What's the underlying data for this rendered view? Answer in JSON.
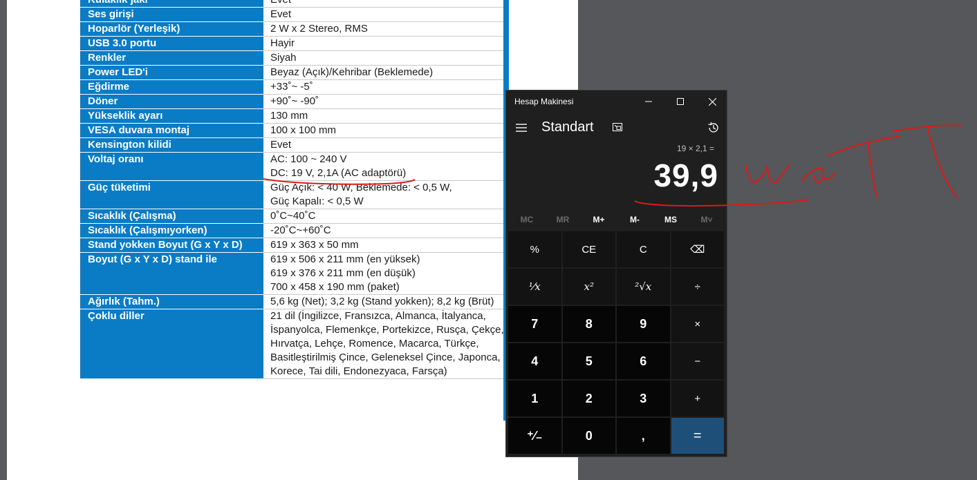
{
  "document": {
    "specs": [
      {
        "label": "Kulaklık jakı",
        "value": [
          "Evet"
        ]
      },
      {
        "label": "Ses girişi",
        "value": [
          "Evet"
        ]
      },
      {
        "label": "Hoparlör (Yerleşik)",
        "value": [
          "2 W x 2 Stereo, RMS"
        ]
      },
      {
        "label": "USB 3.0 portu",
        "value": [
          "Hayir"
        ]
      },
      {
        "label": "Renkler",
        "value": [
          "Siyah"
        ]
      },
      {
        "label": "Power LED'i",
        "value": [
          "Beyaz (Açık)/Kehribar (Beklemede)"
        ]
      },
      {
        "label": "Eğdirme",
        "value": [
          "+33˚~ -5˚"
        ]
      },
      {
        "label": "Döner",
        "value": [
          "+90˚~ -90˚"
        ]
      },
      {
        "label": "Yükseklik ayarı",
        "value": [
          "130 mm"
        ]
      },
      {
        "label": "VESA duvara montaj",
        "value": [
          "100 x 100 mm"
        ]
      },
      {
        "label": "Kensington kilidi",
        "value": [
          "Evet"
        ]
      },
      {
        "label": "Voltaj oranı",
        "value": [
          "AC: 100 ~ 240 V",
          "DC: 19 V, 2,1A (AC adaptörü)"
        ]
      },
      {
        "label": "Güç tüketimi",
        "value": [
          "Güç Açık: < 40 W, Beklemede: < 0,5 W,",
          "Güç Kapalı: < 0,5 W"
        ]
      },
      {
        "label": "Sıcaklık (Çalışma)",
        "value": [
          "0˚C~40˚C"
        ]
      },
      {
        "label": "Sıcaklık (Çalışmıyorken)",
        "value": [
          "-20˚C~+60˚C"
        ]
      },
      {
        "label": "Stand yokken Boyut (G x Y x D)",
        "value": [
          "619 x 363 x 50 mm"
        ]
      },
      {
        "label": "Boyut (G x Y x D) stand ile",
        "value": [
          "619 x 506 x 211 mm (en yüksek)",
          "619 x 376 x 211 mm (en düşük)",
          "700 x 458 x 190 mm (paket)"
        ]
      },
      {
        "label": "Ağırlık (Tahm.)",
        "value": [
          "5,6 kg (Net); 3,2 kg (Stand yokken); 8,2 kg (Brüt)"
        ]
      },
      {
        "label": "Çoklu diller",
        "value": [
          "21 dil (İngilizce, Fransızca, Almanca, İtalyanca, İspanyolca, Flemenkçe, Portekizce, Rusça, Çekçe, Hırvatça, Lehçe, Romence, Macarca, Türkçe, Basitleştirilmiş Çince, Geleneksel Çince, Japonca, Korece, Tai dili, Endonezyaca, Farsça)"
        ]
      }
    ]
  },
  "calculator": {
    "window_title": "Hesap Makinesi",
    "mode": "Standart",
    "expression": "19 × 2,1 =",
    "result": "39,9",
    "memory_buttons": [
      {
        "label": "MC",
        "enabled": false
      },
      {
        "label": "MR",
        "enabled": false
      },
      {
        "label": "M+",
        "enabled": true
      },
      {
        "label": "M-",
        "enabled": true
      },
      {
        "label": "MS",
        "enabled": true
      },
      {
        "label": "M˅",
        "enabled": false
      }
    ],
    "keys": [
      {
        "label": "%",
        "kind": "fn",
        "name": "percent-button"
      },
      {
        "label": "CE",
        "kind": "fn",
        "name": "clear-entry-button"
      },
      {
        "label": "C",
        "kind": "fn",
        "name": "clear-button"
      },
      {
        "label": "⌫",
        "kind": "fn",
        "name": "backspace-button"
      },
      {
        "label": "¹⁄x",
        "kind": "fn",
        "name": "reciprocal-button",
        "italic": true
      },
      {
        "label": "x²",
        "kind": "fn",
        "name": "square-button",
        "italic": true
      },
      {
        "label": "²√x",
        "kind": "fn",
        "name": "square-root-button",
        "italic": true
      },
      {
        "label": "÷",
        "kind": "fn",
        "name": "divide-button"
      },
      {
        "label": "7",
        "kind": "num",
        "name": "digit-7-button"
      },
      {
        "label": "8",
        "kind": "num",
        "name": "digit-8-button"
      },
      {
        "label": "9",
        "kind": "num",
        "name": "digit-9-button"
      },
      {
        "label": "×",
        "kind": "fn",
        "name": "multiply-button"
      },
      {
        "label": "4",
        "kind": "num",
        "name": "digit-4-button"
      },
      {
        "label": "5",
        "kind": "num",
        "name": "digit-5-button"
      },
      {
        "label": "6",
        "kind": "num",
        "name": "digit-6-button"
      },
      {
        "label": "−",
        "kind": "fn",
        "name": "subtract-button"
      },
      {
        "label": "1",
        "kind": "num",
        "name": "digit-1-button"
      },
      {
        "label": "2",
        "kind": "num",
        "name": "digit-2-button"
      },
      {
        "label": "3",
        "kind": "num",
        "name": "digit-3-button"
      },
      {
        "label": "+",
        "kind": "fn",
        "name": "add-button"
      },
      {
        "label": "⁺⁄₋",
        "kind": "num",
        "name": "negate-button"
      },
      {
        "label": "0",
        "kind": "num",
        "name": "digit-0-button"
      },
      {
        "label": ",",
        "kind": "num",
        "name": "decimal-button"
      },
      {
        "label": "=",
        "kind": "eq",
        "name": "equals-button"
      }
    ]
  },
  "colors": {
    "table_header_blue": "#0a7cc6",
    "annotation_red": "#e01818",
    "equals_blue": "#1e4f78"
  }
}
